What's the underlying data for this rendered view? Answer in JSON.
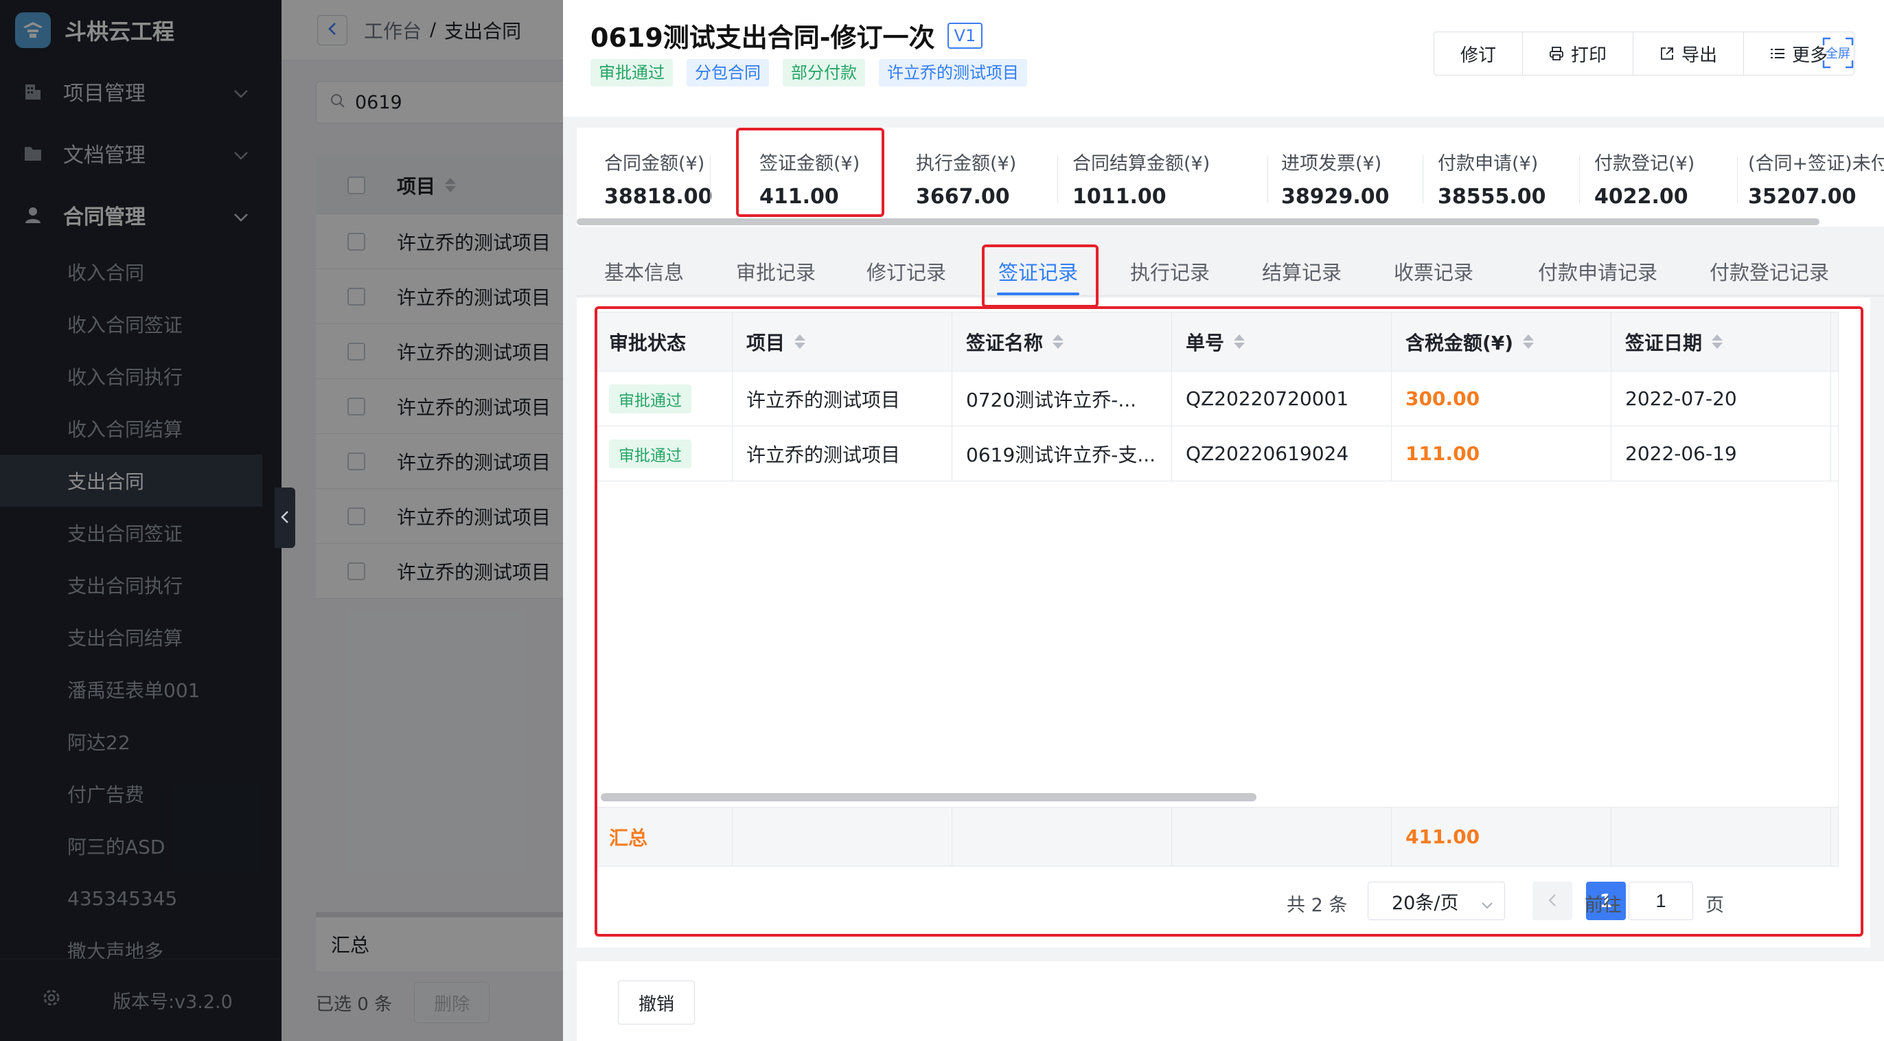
{
  "app": {
    "title": "斗栱云工程",
    "version": "版本号:v3.2.0"
  },
  "sidebar": {
    "groups": [
      {
        "label": "项目管理",
        "icon": "building-icon"
      },
      {
        "label": "文档管理",
        "icon": "folder-icon"
      },
      {
        "label": "合同管理",
        "icon": "user-icon"
      }
    ],
    "items": [
      {
        "label": "收入合同"
      },
      {
        "label": "收入合同签证"
      },
      {
        "label": "收入合同执行"
      },
      {
        "label": "收入合同结算"
      },
      {
        "label": "支出合同",
        "active": true
      },
      {
        "label": "支出合同签证"
      },
      {
        "label": "支出合同执行"
      },
      {
        "label": "支出合同结算"
      },
      {
        "label": "潘禹廷表单001"
      },
      {
        "label": "阿达22"
      },
      {
        "label": "付广告费"
      },
      {
        "label": "阿三的ASD"
      },
      {
        "label": "435345345"
      },
      {
        "label": "撒大声地多"
      }
    ]
  },
  "background_page": {
    "breadcrumb": {
      "root": "工作台",
      "sep": "/",
      "current": "支出合同"
    },
    "search_value": "0619",
    "table_header": "项目",
    "rows": [
      "许立乔的测试项目",
      "许立乔的测试项目",
      "许立乔的测试项目",
      "许立乔的测试项目",
      "许立乔的测试项目",
      "许立乔的测试项目",
      "许立乔的测试项目"
    ],
    "summary_label": "汇总",
    "selected_text": "已选 0 条",
    "delete_label": "删除"
  },
  "drawer": {
    "title": "0619测试支出合同-修订一次",
    "version_badge": "V1",
    "tags": [
      {
        "label": "审批通过",
        "color": "green"
      },
      {
        "label": "分包合同",
        "color": "blue"
      },
      {
        "label": "部分付款",
        "color": "green"
      },
      {
        "label": "许立乔的测试项目",
        "color": "blue"
      }
    ],
    "actions": {
      "revise": "修订",
      "print": "打印",
      "export": "导出",
      "more": "更多",
      "fullscreen": "全屏"
    },
    "stats": [
      {
        "label": "合同金额(¥)",
        "value": "38818.00"
      },
      {
        "label": "签证金额(¥)",
        "value": "411.00"
      },
      {
        "label": "执行金额(¥)",
        "value": "3667.00"
      },
      {
        "label": "合同结算金额(¥)",
        "value": "1011.00"
      },
      {
        "label": "进项发票(¥)",
        "value": "38929.00"
      },
      {
        "label": "付款申请(¥)",
        "value": "38555.00"
      },
      {
        "label": "付款登记(¥)",
        "value": "4022.00"
      },
      {
        "label": "(合同+签证)未付",
        "value": "35207.00"
      }
    ],
    "tabs": [
      {
        "label": "基本信息"
      },
      {
        "label": "审批记录"
      },
      {
        "label": "修订记录"
      },
      {
        "label": "签证记录",
        "active": true
      },
      {
        "label": "执行记录"
      },
      {
        "label": "结算记录"
      },
      {
        "label": "收票记录"
      },
      {
        "label": "付款申请记录"
      },
      {
        "label": "付款登记记录"
      }
    ],
    "table": {
      "columns": [
        "审批状态",
        "项目",
        "签证名称",
        "单号",
        "含税金额(¥)",
        "签证日期"
      ],
      "rows": [
        {
          "status": "审批通过",
          "project": "许立乔的测试项目",
          "name": "0720测试许立乔-...",
          "number": "QZ20220720001",
          "amount": "300.00",
          "date": "2022-07-20"
        },
        {
          "status": "审批通过",
          "project": "许立乔的测试项目",
          "name": "0619测试许立乔-支...",
          "number": "QZ20220619024",
          "amount": "111.00",
          "date": "2022-06-19"
        }
      ],
      "summary": {
        "label": "汇总",
        "amount": "411.00"
      }
    },
    "pagination": {
      "total": "共 2 条",
      "page_size": "20条/页",
      "current": "1",
      "goto_label": "前往",
      "goto_value": "1",
      "page_suffix": "页"
    },
    "footer": {
      "revoke": "撤销"
    }
  },
  "colors": {
    "accent": "#2f7df6",
    "amount": "#f57c1f",
    "success": "#27a567",
    "highlight": "#e5202b",
    "sidebar_bg": "#1f242c"
  }
}
